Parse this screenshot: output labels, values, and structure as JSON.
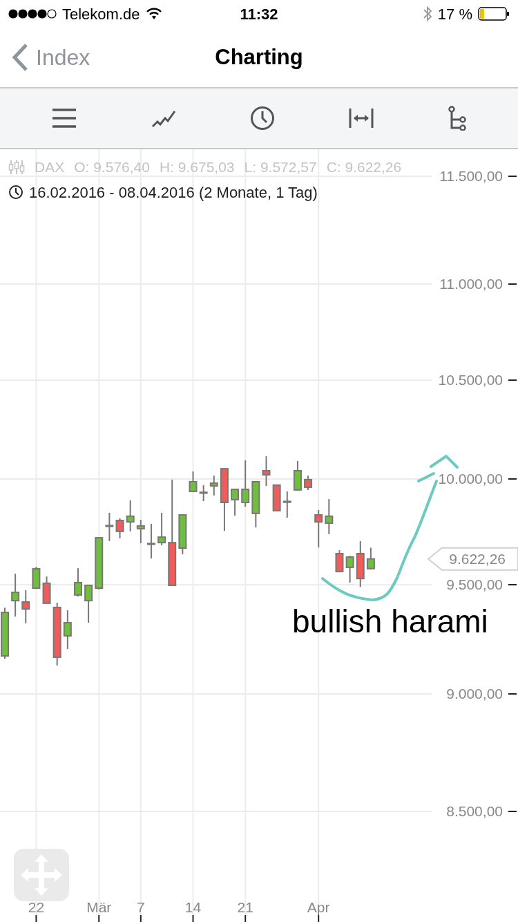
{
  "status_bar": {
    "carrier": "Telekom.de",
    "time": "11:32",
    "battery": "17 %"
  },
  "nav_bar": {
    "back_label": "Index",
    "title": "Charting"
  },
  "quote": {
    "instrument": "DAX",
    "values": [
      "O: 9.576,40",
      "H: 9.675,03",
      "L: 9.572,57",
      "C: 9.622,26"
    ],
    "date_range": "16.02.2016 - 08.04.2016 (2 Monate, 1 Tag)"
  },
  "chart": {
    "current_price": "9.622,26",
    "y_axis_labels": [
      "11.500,00",
      "11.000,00",
      "10.500,00",
      "10.000,00",
      "9.500,00",
      "9.000,00",
      "8.500,00"
    ],
    "x_axis_labels": [
      "22",
      "Mär",
      "7",
      "14",
      "21",
      "Apr"
    ],
    "annotation": "bullish harami"
  }
}
